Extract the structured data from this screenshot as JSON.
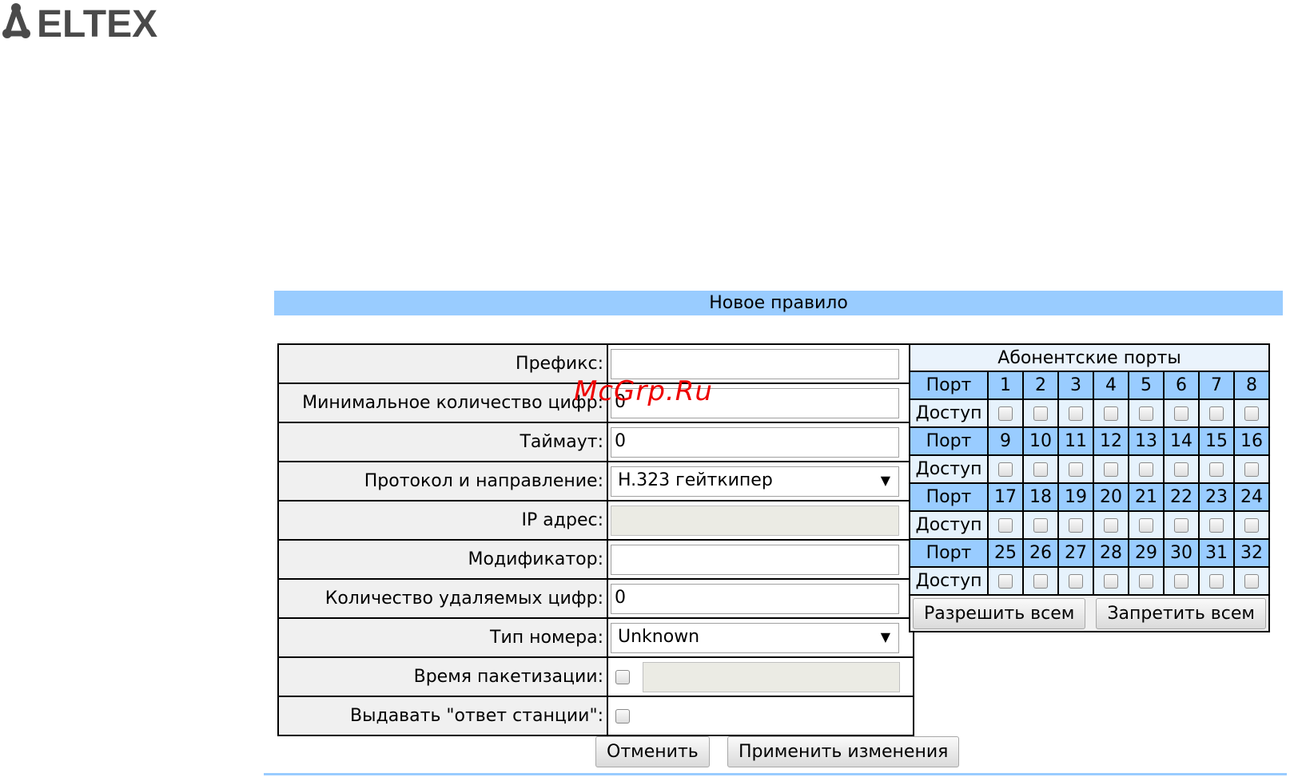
{
  "brand": {
    "logo_text": "ELTEX"
  },
  "header": {
    "title": "Новое правило"
  },
  "watermark": "McGrp.Ru",
  "form": {
    "prefix": {
      "label": "Префикс:",
      "value": ""
    },
    "min_digits": {
      "label": "Минимальное количество цифр:",
      "value": "0"
    },
    "timeout": {
      "label": "Таймаут:",
      "value": "0"
    },
    "protocol": {
      "label": "Протокол и направление:",
      "value": "H.323 гейткипер"
    },
    "ip": {
      "label": "IP адрес:",
      "value": ""
    },
    "modifier": {
      "label": "Модификатор:",
      "value": ""
    },
    "remove_digits": {
      "label": "Количество удаляемых цифр:",
      "value": "0"
    },
    "number_type": {
      "label": "Тип номера:",
      "value": "Unknown"
    },
    "packet_time": {
      "label": "Время пакетизации:",
      "checked": false,
      "value": ""
    },
    "station_answer": {
      "label": "Выдавать \"ответ станции\":",
      "checked": false
    }
  },
  "ports": {
    "title": "Абонентские порты",
    "port_label": "Порт",
    "access_label": "Доступ",
    "rows": [
      [
        "1",
        "2",
        "3",
        "4",
        "5",
        "6",
        "7",
        "8"
      ],
      [
        "9",
        "10",
        "11",
        "12",
        "13",
        "14",
        "15",
        "16"
      ],
      [
        "17",
        "18",
        "19",
        "20",
        "21",
        "22",
        "23",
        "24"
      ],
      [
        "25",
        "26",
        "27",
        "28",
        "29",
        "30",
        "31",
        "32"
      ]
    ],
    "allow_all": "Разрешить всем",
    "deny_all": "Запретить всем"
  },
  "actions": {
    "cancel": "Отменить",
    "apply": "Применить изменения"
  },
  "colors": {
    "header_bg": "#99ccff",
    "port_header_bg": "#99ccff",
    "label_bg": "#f0f0f0",
    "logo": "#4a4a4a"
  }
}
